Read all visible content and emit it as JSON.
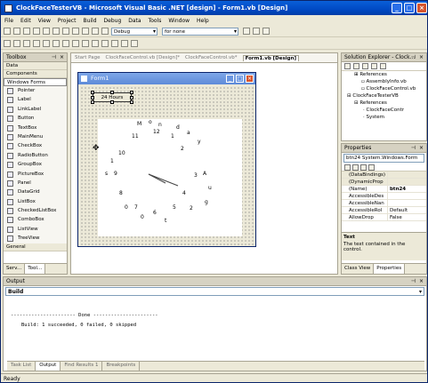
{
  "window": {
    "title": "ClockFaceTesterVB - Microsoft Visual Basic .NET [design] - Form1.vb [Design]"
  },
  "menu": [
    "File",
    "Edit",
    "View",
    "Project",
    "Build",
    "Debug",
    "Data",
    "Tools",
    "Window",
    "Help"
  ],
  "toolbar": {
    "config": "Debug",
    "find": "for none"
  },
  "toolbox": {
    "title": "Toolbox",
    "sections": [
      "Data",
      "Components",
      "Windows Forms"
    ],
    "items": [
      "Pointer",
      "Label",
      "LinkLabel",
      "Button",
      "TextBox",
      "MainMenu",
      "CheckBox",
      "RadioButton",
      "GroupBox",
      "PictureBox",
      "Panel",
      "DataGrid",
      "ListBox",
      "CheckedListBox",
      "ComboBox",
      "ListView",
      "TreeView"
    ],
    "general": "General",
    "tabs": [
      "Serv...",
      "Tool..."
    ]
  },
  "doc_tabs": [
    "Start Page",
    "ClockFaceControl.vb [Design]*",
    "ClockFaceControl.vb*",
    "Form1.vb [Design]"
  ],
  "form": {
    "title": "Form1",
    "button_label": "24 Hours"
  },
  "clock_labels": [
    "M",
    "o",
    "n",
    "d",
    "a",
    "y",
    "12",
    "1",
    "2",
    "3",
    "4",
    "5",
    "6",
    "7",
    "8",
    "9",
    "10",
    "11",
    "A",
    "u",
    "g",
    "2",
    "t",
    "0",
    "0",
    "s",
    "1"
  ],
  "solution": {
    "title": "Solution Explorer - Clock...",
    "tree": [
      "References",
      "AssemblyInfo.vb",
      "ClockFaceControl.vb",
      "ClockFaceTesterVB",
      "References",
      "ClockFaceContr",
      "System"
    ]
  },
  "properties": {
    "title": "Properties",
    "selected": "btn24  System.Windows.Form",
    "rows": [
      {
        "name": "(DataBindings)",
        "value": ""
      },
      {
        "name": "(DynamicProp",
        "value": ""
      },
      {
        "name": "(Name)",
        "value": "btn24"
      },
      {
        "name": "AccessibleDes",
        "value": ""
      },
      {
        "name": "AccessibleNan",
        "value": ""
      },
      {
        "name": "AccessibleRol",
        "value": "Default"
      },
      {
        "name": "AllowDrop",
        "value": "False"
      }
    ],
    "desc_title": "Text",
    "desc_text": "The text contained in the control.",
    "tabs": [
      "Class View",
      "Properties"
    ]
  },
  "output": {
    "title": "Output",
    "source": "Build",
    "line1": "---------------------- Done ----------------------",
    "line2": "Build: 1 succeeded, 0 failed, 0 skipped",
    "tabs": [
      "Task List",
      "Output",
      "Find Results 1",
      "Breakpoints"
    ]
  },
  "status": "Ready"
}
